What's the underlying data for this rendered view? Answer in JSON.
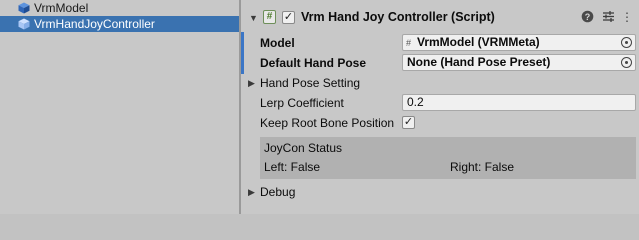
{
  "hierarchy": {
    "items": [
      {
        "label": "VrmModel",
        "icon": "gameobject-cube-icon",
        "selected": false
      },
      {
        "label": "VrmHandJoyController",
        "icon": "gameobject-cube-icon",
        "selected": true
      }
    ]
  },
  "inspector": {
    "component": {
      "title": "Vrm Hand Joy Controller (Script)",
      "script_icon": "#",
      "enabled": true,
      "actions": [
        "help-icon",
        "presets-icon",
        "menu-icon"
      ]
    },
    "fields": {
      "model": {
        "label": "Model",
        "value": "VrmModel (VRMMeta)",
        "icon_text": "#"
      },
      "default_hand_pose": {
        "label": "Default Hand Pose",
        "value": "None (Hand Pose Preset)"
      },
      "hand_pose_setting": {
        "label": "Hand Pose Setting"
      },
      "lerp_coefficient": {
        "label": "Lerp Coefficient",
        "value": "0.2"
      },
      "keep_root_bone_position": {
        "label": "Keep Root Bone Position",
        "checked": true
      }
    },
    "status": {
      "title": "JoyCon Status",
      "left": "Left: False",
      "right": "Right: False"
    },
    "debug": {
      "label": "Debug"
    }
  },
  "colors": {
    "selection": "#3a72b0",
    "cube": "#2f66b8",
    "accent_edge": "#3b76c6",
    "script_badge": "#4f7b2e"
  }
}
